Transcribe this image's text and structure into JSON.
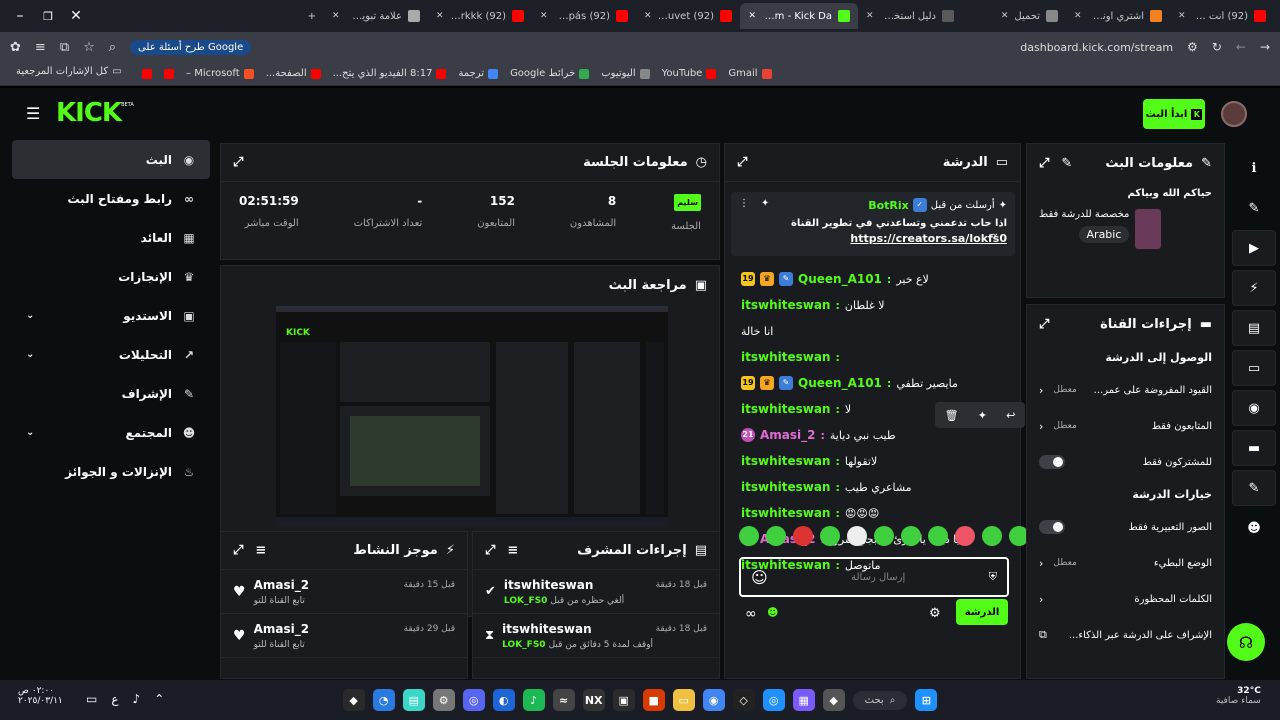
{
  "browser": {
    "tabs": [
      {
        "label": "(92) أنت طيب -",
        "fav": "youtube",
        "color": "#ff0000"
      },
      {
        "label": "اشتري اونلاين بأفضل",
        "fav": "shop",
        "color": "#f58220"
      },
      {
        "label": "تحميل",
        "fav": "download",
        "color": "#888888"
      },
      {
        "label": "دليل استخدام ER",
        "fav": "doc",
        "color": "#5a5a5a"
      },
      {
        "label": "Stream - Kick Da",
        "fav": "kick",
        "color": "#53fc18"
      },
      {
        "label": "(92) Bôa - Duvet",
        "fav": "youtube",
        "color": "#ff0000"
      },
      {
        "label": "(92) Al Compás",
        "fav": "youtube",
        "color": "#ff0000"
      },
      {
        "label": "(92) L.K. Ft. Eirkkk",
        "fav": "youtube",
        "color": "#ff0000"
      },
      {
        "label": "علامة تبويب جديدة",
        "fav": "chrome",
        "color": "#aaaaaa"
      }
    ],
    "url": "dashboard.kick.com/stream",
    "google_pill": "طرح أسئلة على Google",
    "bookmarks": [
      "Gmail",
      "YouTube",
      "اليوتيوب",
      "خرائط Google",
      "ترجمة",
      "8:17 الفيديو الذي يتح...",
      "الصفحة...",
      "Microsoft –"
    ],
    "bookmarks_folder": "كل الإشارات المرجعية"
  },
  "header": {
    "logo": "KICK",
    "logo_beta": "BETA",
    "start_stream": "ابدأ البث"
  },
  "sidebar": {
    "items": [
      {
        "label": "البث",
        "icon": "stream-icon",
        "glyph": "◉",
        "active": true,
        "expand": false
      },
      {
        "label": "رابط ومفتاح البث",
        "icon": "link-icon",
        "glyph": "∞",
        "active": false,
        "expand": false
      },
      {
        "label": "العائد",
        "icon": "revenue-icon",
        "glyph": "▦",
        "active": false,
        "expand": false
      },
      {
        "label": "الإنجازات",
        "icon": "trophy-icon",
        "glyph": "♛",
        "active": false,
        "expand": false
      },
      {
        "label": "الاستديو",
        "icon": "studio-icon",
        "glyph": "▣",
        "active": false,
        "expand": true
      },
      {
        "label": "التحليلات",
        "icon": "analytics-icon",
        "glyph": "↗",
        "active": false,
        "expand": true
      },
      {
        "label": "الإشراف",
        "icon": "wrench-icon",
        "glyph": "✎",
        "active": false,
        "expand": false
      },
      {
        "label": "المجتمع",
        "icon": "community-icon",
        "glyph": "☻",
        "active": false,
        "expand": true
      },
      {
        "label": "الإنزالات و الجوائز",
        "icon": "gift-icon",
        "glyph": "♨",
        "active": false,
        "expand": false
      }
    ]
  },
  "session": {
    "title": "معلومات الجلسة",
    "stats": [
      {
        "value": "02:51:59",
        "label": "الوقت مباشر"
      },
      {
        "value": "-",
        "label": "تعداد الاشتراكات"
      },
      {
        "value": "152",
        "label": "المتابعون"
      },
      {
        "value": "8",
        "label": "المشاهدون"
      },
      {
        "value": "سليم",
        "label": "الجلسة"
      }
    ]
  },
  "preview": {
    "title": "مراجعة البث"
  },
  "activity": {
    "title": "موجز النشاط",
    "items": [
      {
        "user": "Amasi_2",
        "text": "تابع القناة للتو",
        "time": "قبل 15 دقيقة"
      },
      {
        "user": "Amasi_2",
        "text": "تابع القناة للتو",
        "time": "قبل 29 دقيقة"
      }
    ]
  },
  "modactions": {
    "title": "إجراءات المشرف",
    "items": [
      {
        "user": "itswhiteswan",
        "text": "ألغي حظره من قبل",
        "target": "LOK_FS0",
        "time": "قبل 18 دقيقة"
      },
      {
        "user": "itswhiteswan",
        "text": "أوقف لمدة 5 دقائق من قبل",
        "target": "LOK_FS0",
        "time": "قبل 18 دقيقة"
      }
    ]
  },
  "chat": {
    "title": "الدرشة",
    "pinned": {
      "by": "أرسلت من قبل",
      "user": "BotRix",
      "text": "اذا حاب تدعمني وتساعدني في تطوير القناة",
      "link": "https://creators.sa/lokfs0"
    },
    "messages": [
      {
        "user": "Queen_A101",
        "color": "#53fc18",
        "text": "لاع خير",
        "badge": "19"
      },
      {
        "user": "itswhiteswan",
        "color": "#53fc18",
        "text": "لا غلطان",
        "badge": ""
      },
      {
        "user": "",
        "color": "#53fc18",
        "text": "انا خالة",
        "badge": ""
      },
      {
        "user": "itswhiteswan",
        "color": "#53fc18",
        "text": "",
        "badge": ""
      },
      {
        "user": "Queen_A101",
        "color": "#53fc18",
        "text": "مايصير تطفي",
        "badge": "19"
      },
      {
        "user": "itswhiteswan",
        "color": "#53fc18",
        "text": "لا",
        "badge": ""
      },
      {
        "user": "Amasi_2",
        "color": "#e36bd6",
        "text": "طيب نبي دياية",
        "badge": "21"
      },
      {
        "user": "itswhiteswan",
        "color": "#53fc18",
        "text": "لاتقولها",
        "badge": ""
      },
      {
        "user": "itswhiteswan",
        "color": "#53fc18",
        "text": "مشاعري طيب",
        "badge": ""
      },
      {
        "user": "itswhiteswan",
        "color": "#53fc18",
        "text": "😡😡😡",
        "badge": ""
      },
      {
        "user": "Amasi_2",
        "color": "#e36bd6",
        "text": "يا دياية يا قارئ يا أبجي سريع",
        "badge": "21"
      },
      {
        "user": "itswhiteswan",
        "color": "#53fc18",
        "text": "ماتوصل",
        "badge": ""
      }
    ],
    "placeholder": "إرسال رسالة",
    "send": "الدرشة"
  },
  "streaminfo": {
    "title": "معلومات البث",
    "greeting": "حياكم الله وبياكم",
    "desc": "مخصصة للدرشة فقط",
    "language": "Arabic"
  },
  "channelactions": {
    "title": "إجراءات القناة",
    "chat_access_title": "الوصول إلى الدرشة",
    "chat_access": [
      {
        "label": "القيود المفروضة على عمر...",
        "value": "معطل",
        "kind": "arrow"
      },
      {
        "label": "المتابعون فقط",
        "value": "معطل",
        "kind": "arrow"
      },
      {
        "label": "للمشتركون فقط",
        "value": "",
        "kind": "toggle"
      }
    ],
    "chat_options_title": "خيارات الدرشة",
    "chat_options": [
      {
        "label": "الصور التعبيرية فقط",
        "value": "",
        "kind": "toggle"
      },
      {
        "label": "الوضع البطيء",
        "value": "معطل",
        "kind": "arrow"
      },
      {
        "label": "الكلمات المحظورة",
        "value": "",
        "kind": "arrow"
      },
      {
        "label": "الإشراف على الدرشة عبر الذكاء...",
        "value": "",
        "kind": "ext"
      }
    ]
  },
  "taskbar": {
    "search": "بحث",
    "weather_temp": "32°C",
    "weather_text": "سماء صافية",
    "time": "٠٢:٠٠ ص",
    "date": "٢٠٢٥/٠٣/١١",
    "lang": "ع"
  }
}
